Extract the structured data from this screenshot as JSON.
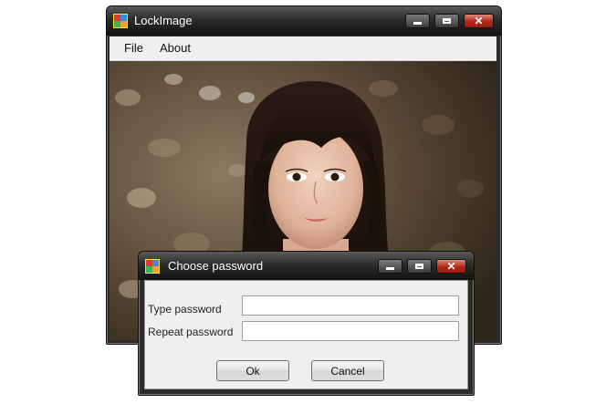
{
  "main_window": {
    "title": "LockImage",
    "menu": [
      "File",
      "About"
    ]
  },
  "dialog": {
    "title": "Choose password",
    "fields": [
      {
        "label": "Type password",
        "value": ""
      },
      {
        "label": "Repeat password",
        "value": ""
      }
    ],
    "ok_label": "Ok",
    "cancel_label": "Cancel"
  },
  "icons": {
    "app": "app-icon",
    "minimize": "minimize-icon",
    "maximize": "maximize-icon",
    "close": "close-icon"
  },
  "colors": {
    "title_bar": "#1e1e1e",
    "close_button": "#b2261a",
    "window_body": "#efefef"
  }
}
